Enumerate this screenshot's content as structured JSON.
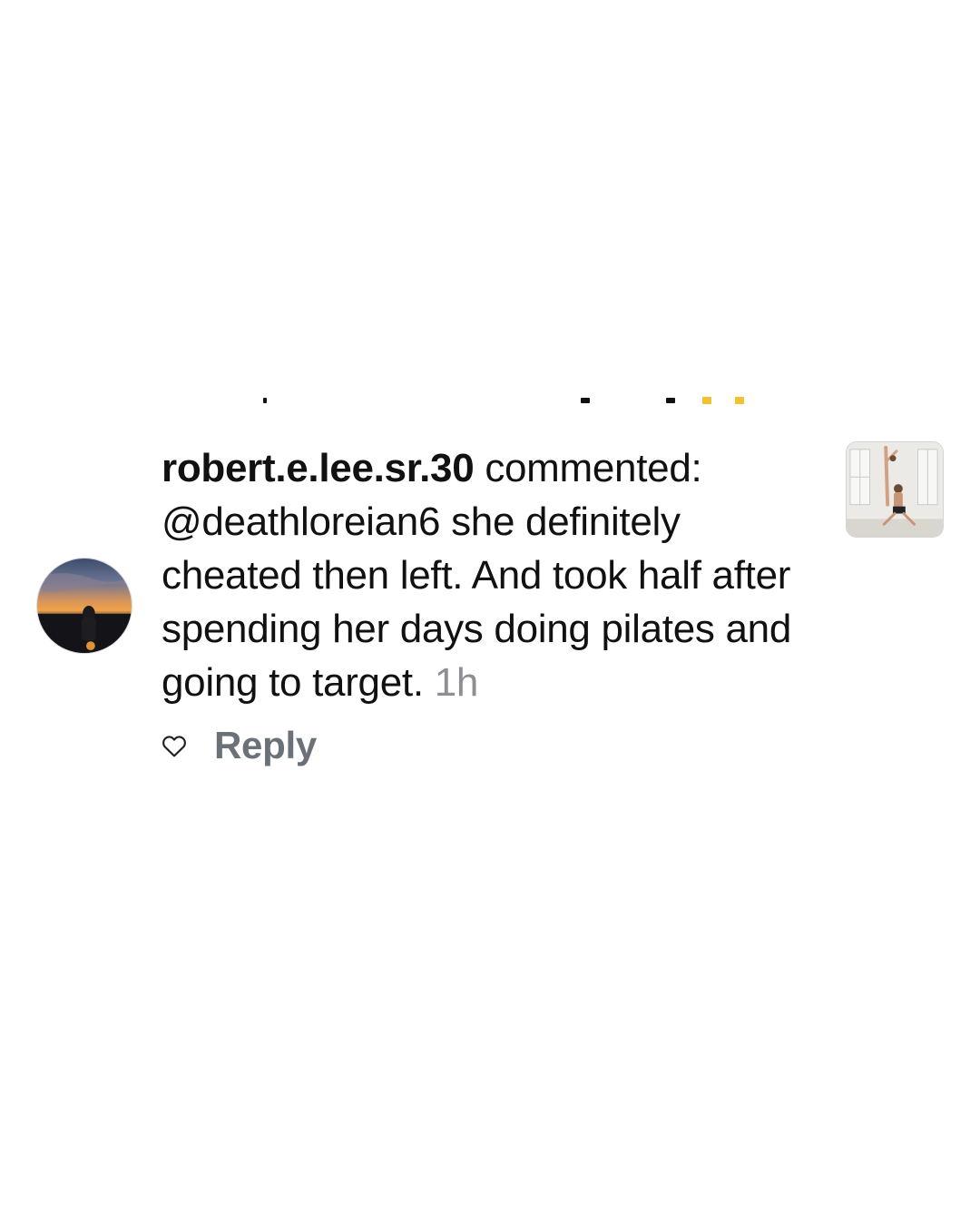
{
  "comment": {
    "username": "robert.e.lee.sr.30",
    "action_text": "commented:",
    "mention": "@deathloreian6",
    "body": "she definitely cheated then left. And took half after spending her days doing pilates and going to target.",
    "timestamp": "1h",
    "avatar_icon": "sunset-profile-photo",
    "thumbnail_icon": "post-thumbnail-photo"
  },
  "actions": {
    "like_icon": "heart-outline-icon",
    "reply_label": "Reply"
  },
  "colors": {
    "text": "#111111",
    "muted": "#8e8e93",
    "reply": "#6b7178",
    "background": "#ffffff"
  }
}
